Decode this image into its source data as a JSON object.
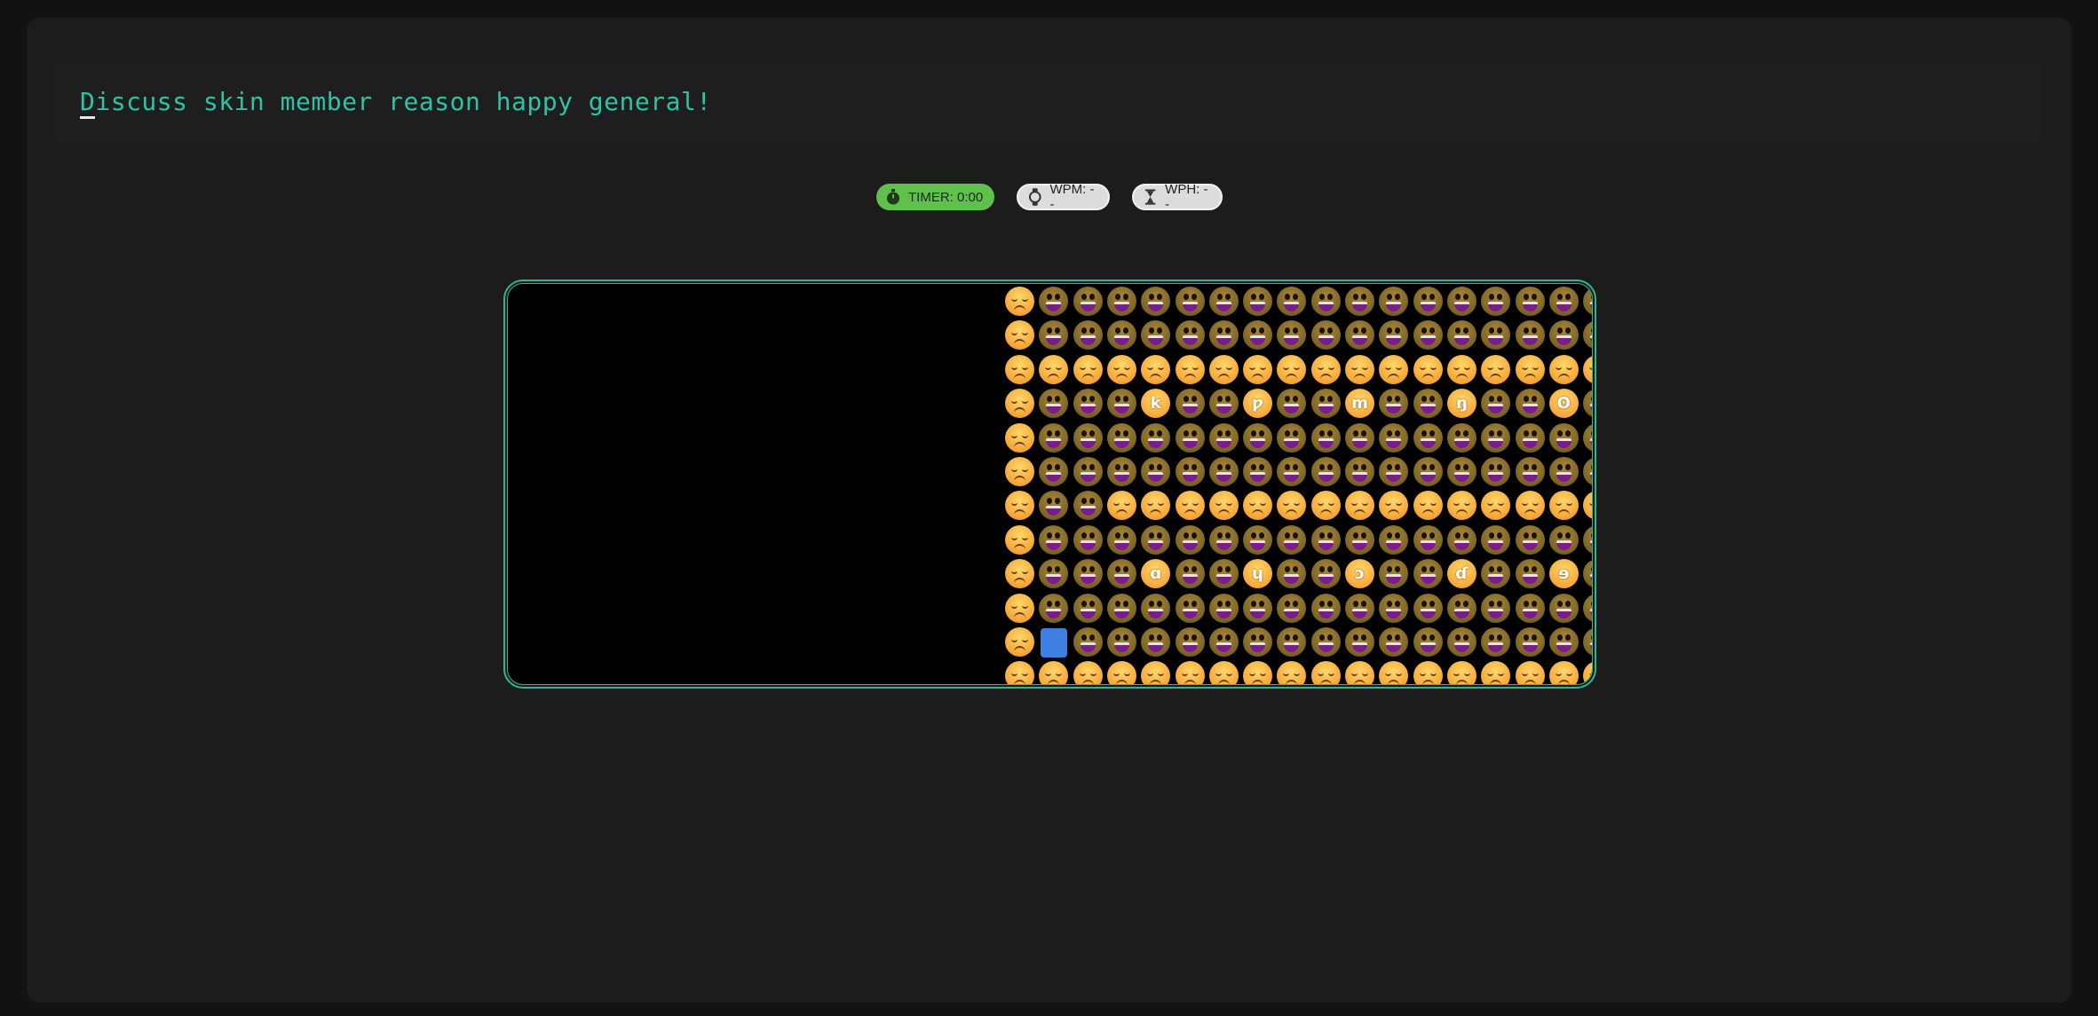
{
  "prompt": {
    "first_char": "D",
    "rest": "iscuss skin member reason happy general!"
  },
  "stats": {
    "timer_label": "TIMER: 0:00",
    "wpm_label": "WPM: --",
    "wph_label": "WPH: --"
  },
  "colors": {
    "accent": "#2ec3a8",
    "timer_bg": "#5fc04b",
    "board_border": "#2fb58f",
    "player": "#3f7fe0"
  },
  "board": {
    "legend": {
      "f": "frown-face",
      "g": "grin-face",
      "L": "letter-face",
      "P": "player"
    },
    "rows": [
      "fggggggggggggggggg",
      "fggggggggggggggggg",
      "ffffffffffffffffff",
      "fgggLggLggLggLggLg",
      "fggggggggggggggggg",
      "fggggggggggggggggg",
      "fggfffffffffffffff",
      "fggggggggggggggggg",
      "fgggLggLggLggLggLg",
      "fggggggggggggggggg",
      "fPgggggggggggggggg",
      "ffffffffffffffffff"
    ],
    "letters": [
      [
        "k",
        "ƿ",
        "m",
        "ŋ",
        "ʘ"
      ],
      [
        "ɑ",
        "ɥ",
        "ɔ",
        "ɗ",
        "ɘ"
      ]
    ]
  }
}
